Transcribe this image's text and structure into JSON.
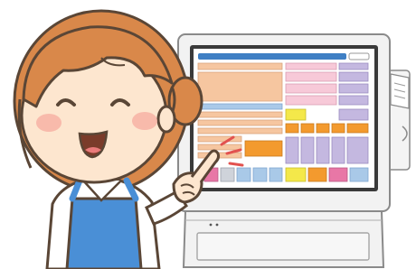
{
  "colors": {
    "outline": "#5a4636",
    "hair": "#d9884a",
    "hair_shadow": "#c0703a",
    "skin": "#fde6cf",
    "cheek": "#f7b2a5",
    "apron": "#4a8fd6",
    "shirt": "#ffffff",
    "terminal_body": "#f2f2f2",
    "terminal_edge": "#c9c9c9",
    "screen_frame": "#3a3a3a",
    "screen_bg": "#ffffff",
    "header_bar": "#3f7fc4",
    "peach_button": "#f6c6a0",
    "pink_button": "#f7c9d8",
    "lavender_button": "#c4b8e0",
    "yellow_button": "#f4e84a",
    "orange_button": "#f39a2e",
    "light_blue_button": "#a9c9e8",
    "magenta_button": "#e877a6",
    "gray_button": "#cfd3da",
    "sparkle": "#e2524f"
  },
  "illustration": {
    "subject": "smiling-staff-woman-pointing",
    "object": "pos-register-touchscreen",
    "accessory": "receipt-printer"
  }
}
